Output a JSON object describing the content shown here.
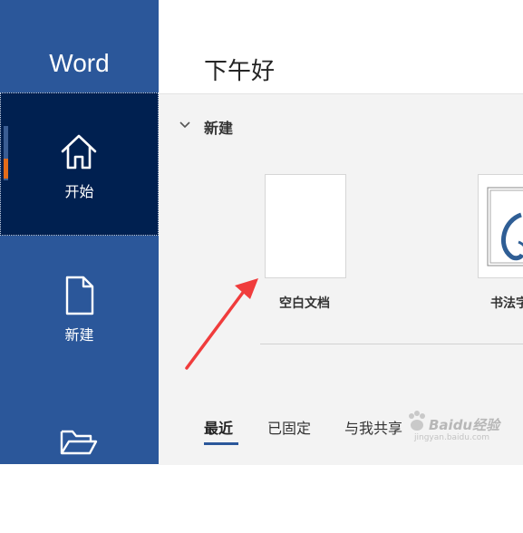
{
  "sidebar": {
    "app_name": "Word",
    "items": [
      {
        "label": "开始",
        "icon": "home-icon",
        "active": true
      },
      {
        "label": "新建",
        "icon": "new-document-icon"
      },
      {
        "label": "",
        "icon": "open-folder-icon"
      }
    ]
  },
  "main": {
    "greeting": "下午好",
    "new_section": {
      "title": "新建",
      "templates": [
        {
          "label": "空白文档"
        },
        {
          "label": "书法字帖"
        }
      ]
    },
    "tabs": [
      {
        "label": "最近",
        "active": true
      },
      {
        "label": "已固定"
      },
      {
        "label": "与我共享"
      }
    ]
  },
  "watermark": {
    "text": "Baidu经验",
    "subtext": "jingyan.baidu.com"
  },
  "colors": {
    "sidebar": "#2b579a",
    "sidebar_active": "#002050",
    "accent_indicator": "#e46c1a",
    "annotation_arrow": "#f03c3c"
  }
}
